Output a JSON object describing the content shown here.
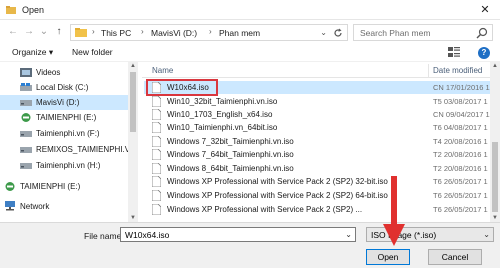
{
  "window": {
    "title": "Open",
    "close_glyph": "✕"
  },
  "nav": {
    "back_glyph": "←",
    "forward_glyph": "→",
    "up_glyph": "↑",
    "recent_glyph": "⌄",
    "breadcrumb": [
      {
        "label": "This PC"
      },
      {
        "label": "MavisVi (D:)"
      },
      {
        "label": "Phan mem"
      }
    ],
    "breadcrumb_separator": "›",
    "search_placeholder": "Search Phan mem"
  },
  "toolbar": {
    "organize_label": "Organize ▾",
    "new_folder_label": "New folder",
    "help_glyph": "?"
  },
  "sidebar": {
    "items": [
      {
        "label": "Videos",
        "icon": "videos-icon"
      },
      {
        "label": "Local Disk (C:)",
        "icon": "drive-icon"
      },
      {
        "label": "MavisVi (D:)",
        "icon": "drive-icon",
        "selected": true
      },
      {
        "label": "TAIMIENPHI (E:)",
        "icon": "usb-drive-icon"
      },
      {
        "label": "Taimienphi.vn (F:)",
        "icon": "drive-icon"
      },
      {
        "label": "REMIXOS_TAIMIENPHI.VN",
        "icon": "drive-icon"
      },
      {
        "label": "Taimienphi.vn (H:)",
        "icon": "drive-icon"
      },
      {
        "label": "TAIMIENPHI (E:)",
        "icon": "usb-drive-icon"
      },
      {
        "label": "Network",
        "icon": "network-icon"
      }
    ]
  },
  "filelist": {
    "columns": {
      "name": "Name",
      "date": "Date modified"
    },
    "files": [
      {
        "name": "W10x64.iso",
        "date": "CN 17/01/2016 1",
        "selected": true
      },
      {
        "name": "Win10_32bit_Taimienphi.vn.iso",
        "date": "T5 03/08/2017 1"
      },
      {
        "name": "Win10_1703_English_x64.iso",
        "date": "CN 09/04/2017 1"
      },
      {
        "name": "Win10_Taimienphi.vn_64bit.iso",
        "date": "T6 04/08/2017 1"
      },
      {
        "name": "Windows 7_32bit_Taimienphi.vn.iso",
        "date": "T4 20/08/2016 1"
      },
      {
        "name": "Windows 7_64bit_Taimienphi.vn.iso",
        "date": "T2 20/08/2016 1"
      },
      {
        "name": "Windows 8_64bit_Taimienphi.vn.iso",
        "date": "T2 20/08/2016 1"
      },
      {
        "name": "Windows XP Professional with Service Pack 2 (SP2) 32-bit.iso",
        "date": "T6 26/05/2017 1"
      },
      {
        "name": "Windows XP Professional with Service Pack 2 (SP2) 64-bit.iso",
        "date": "T6 26/05/2017 1"
      },
      {
        "name": "Windows XP Professional with Service Pack 2 (SP2) ...",
        "date": "T6 26/05/2017 1"
      }
    ]
  },
  "bottom": {
    "file_name_label": "File name:",
    "file_name_value": "W10x64.iso",
    "file_type_value": "ISO Image (*.iso)",
    "open_label": "Open",
    "cancel_label": "Cancel",
    "dropdown_glyph": "⌄"
  },
  "colors": {
    "annotation": "#d9363e",
    "selection": "#cce8ff",
    "accent": "#0078d7"
  }
}
